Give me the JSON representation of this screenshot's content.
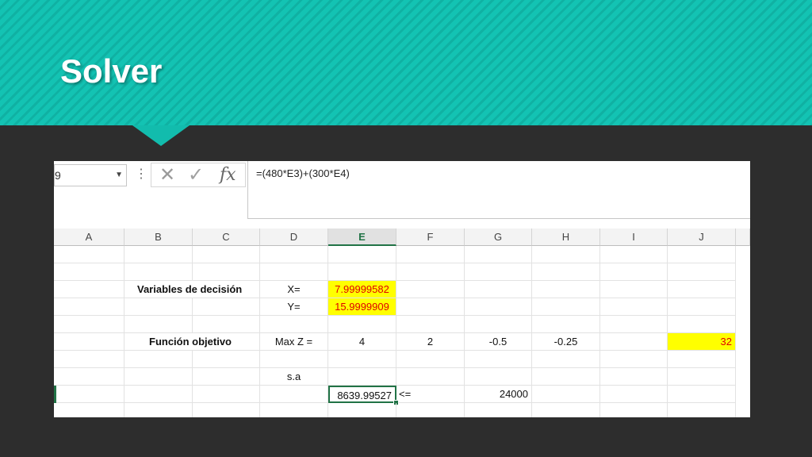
{
  "slide": {
    "title": "Solver"
  },
  "excel": {
    "name_box_value": "9",
    "formula": "=(480*E3)+(300*E4)",
    "columns": [
      "A",
      "B",
      "C",
      "D",
      "E",
      "F",
      "G",
      "H",
      "I",
      "J"
    ],
    "selected_column": "E",
    "cells": {
      "b_variables": "Variables de decisión",
      "d_x": "X=",
      "e_x": "7.99999582",
      "d_y": "Y=",
      "e_y": "15.9999909",
      "b_funcion": "Función objetivo",
      "d_maxz": "Max Z =",
      "e_coef": "4",
      "f_coef": "2",
      "g_coef": "-0.5",
      "h_coef": "-0.25",
      "j_result": "32",
      "d_sa": "s.a",
      "e_constraint": "8639.99527",
      "f_operator": "<=",
      "g_rhs": "24000"
    },
    "colors": {
      "highlight": "#ffff00",
      "highlight_text": "#e00000",
      "selection": "#217346"
    }
  }
}
